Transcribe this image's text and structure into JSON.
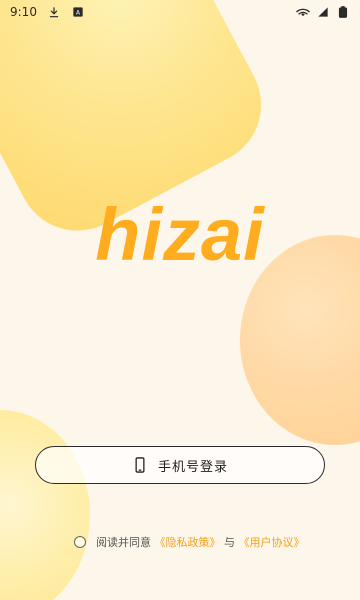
{
  "status_bar": {
    "time": "9:10"
  },
  "logo": {
    "text": "hizai"
  },
  "login": {
    "phone_button_label": "手机号登录"
  },
  "agreement": {
    "prefix": "阅读并同意",
    "privacy_link": "《隐私政策》",
    "middle": "与",
    "terms_link": "《用户协议》"
  },
  "colors": {
    "accent": "#ffad1f",
    "link": "#f2a11e",
    "background": "#fdf6ea"
  },
  "icons": {
    "download": "download-icon",
    "a_badge": "a-badge-icon",
    "wifi": "wifi-icon",
    "signal": "signal-icon",
    "battery": "battery-icon",
    "phone": "phone-icon"
  }
}
